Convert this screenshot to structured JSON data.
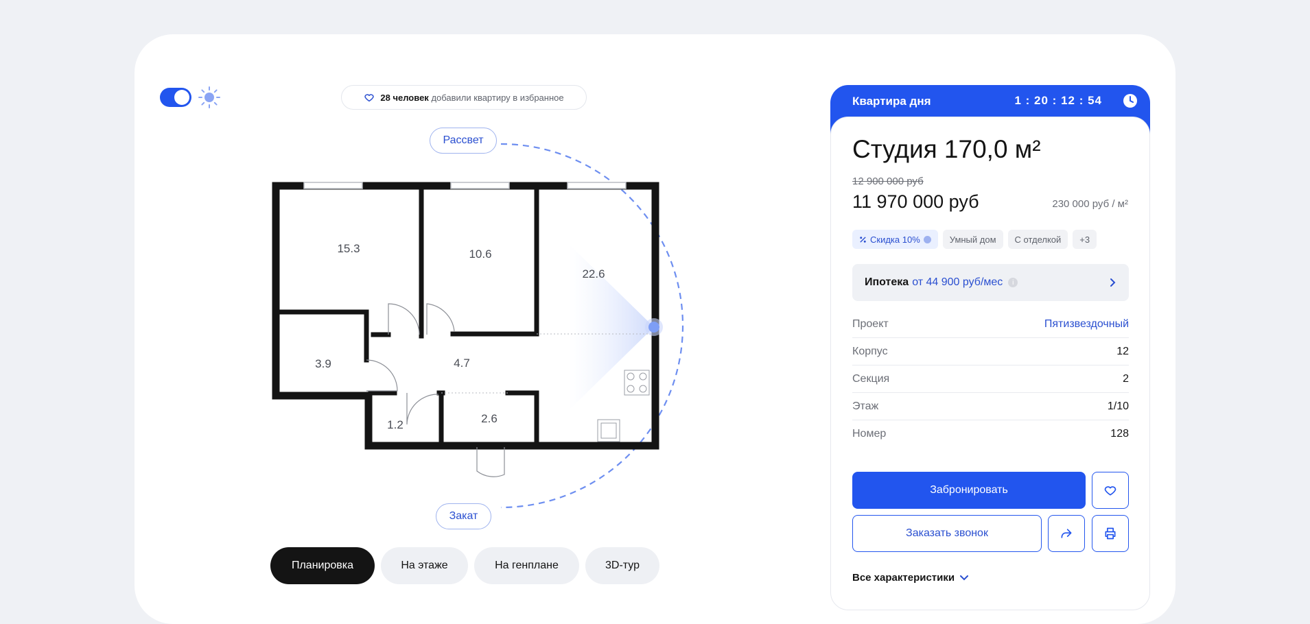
{
  "favorites": {
    "count_text": "28 человек",
    "rest_text": "добавили квартиру в избранное"
  },
  "orbit": {
    "sunrise": "Рассвет",
    "sunset": "Закат"
  },
  "rooms": [
    "15.3",
    "10.6",
    "22.6",
    "3.9",
    "4.7",
    "1.2",
    "2.6"
  ],
  "tabs": [
    {
      "label": "Планировка",
      "active": true
    },
    {
      "label": "На этаже",
      "active": false
    },
    {
      "label": "На генплане",
      "active": false
    },
    {
      "label": "3D-тур",
      "active": false
    }
  ],
  "panel": {
    "header_title": "Квартира дня",
    "timer": "1 : 20 : 12 : 54",
    "title": "Студия 170,0 м²",
    "old_price": "12 900 000 руб",
    "price": "11 970 000 руб",
    "price_per_m": "230 000 руб / м²",
    "chips": [
      "Скидка 10%",
      "Умный дом",
      "С отделкой",
      "+3"
    ],
    "mortgage_label": "Ипотека",
    "mortgage_value": "от 44 900 руб/мес",
    "specs": [
      {
        "key": "Проект",
        "value": "Пятизвездочный"
      },
      {
        "key": "Корпус",
        "value": "12"
      },
      {
        "key": "Секция",
        "value": "2"
      },
      {
        "key": "Этаж",
        "value": "1/10"
      },
      {
        "key": "Номер",
        "value": "128"
      }
    ],
    "book_label": "Забронировать",
    "call_label": "Заказать звонок",
    "all_chars_label": "Все характеристики"
  },
  "colors": {
    "accent": "#2255ee",
    "dark": "#141414",
    "background": "#eff1f5"
  }
}
